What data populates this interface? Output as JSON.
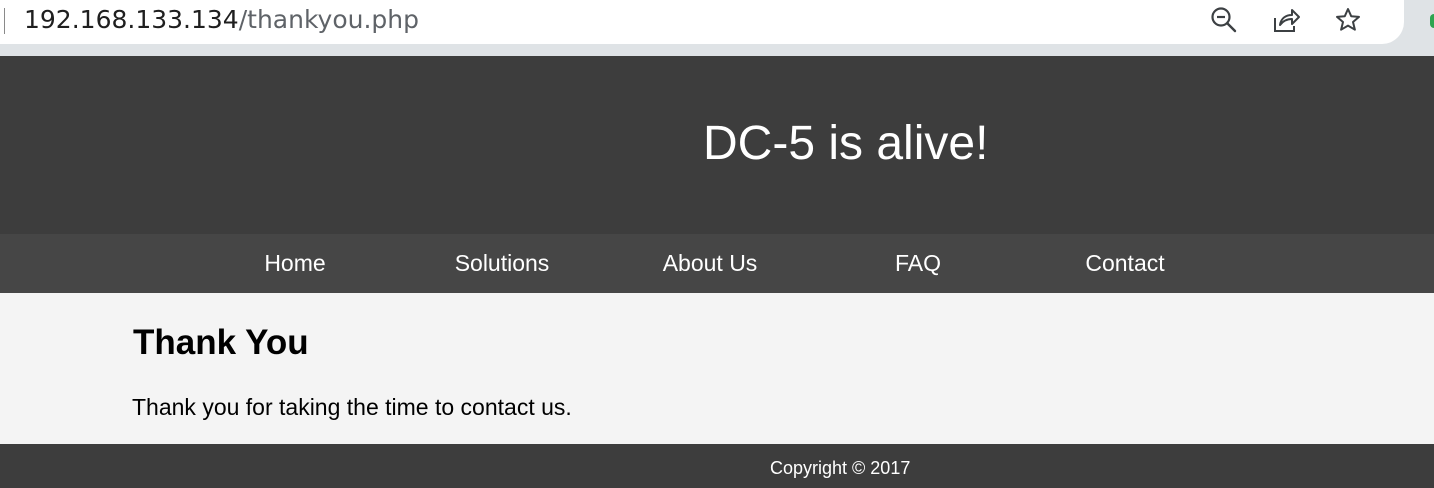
{
  "browser": {
    "url_host": "192.168.133.134",
    "url_path": "/thankyou.php",
    "icons": [
      "zoom-out-icon",
      "share-icon",
      "bookmark-star-icon"
    ]
  },
  "header": {
    "title": "DC-5 is alive!"
  },
  "nav": {
    "items": [
      {
        "label": "Home"
      },
      {
        "label": "Solutions"
      },
      {
        "label": "About Us"
      },
      {
        "label": "FAQ"
      },
      {
        "label": "Contact"
      }
    ]
  },
  "main": {
    "heading": "Thank You",
    "text": "Thank you for taking the time to contact us."
  },
  "footer": {
    "copyright": "Copyright © 2017"
  },
  "colors": {
    "header_bg": "#3d3d3d",
    "nav_bg": "#464646",
    "content_bg": "#f4f4f4",
    "footer_bg": "#3d3d3d"
  }
}
